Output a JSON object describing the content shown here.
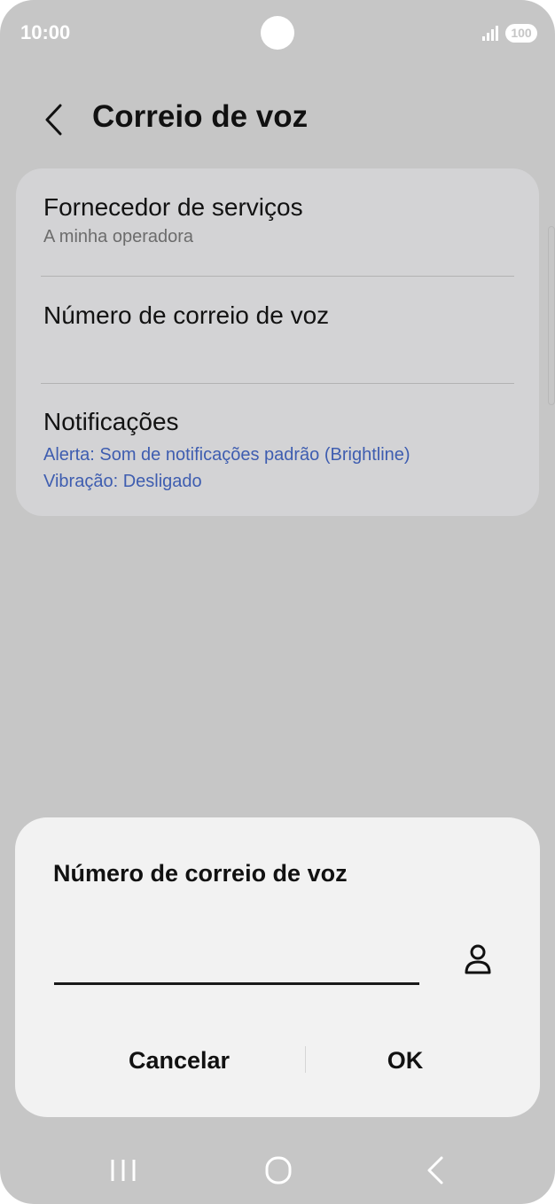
{
  "status_bar": {
    "time": "10:00",
    "battery": "100",
    "colors": {
      "icons": "#ffffff"
    }
  },
  "header": {
    "back_icon": "chevron-left-icon",
    "title": "Correio de voz"
  },
  "settings": {
    "items": [
      {
        "title": "Fornecedor de serviços",
        "subtitle": "A minha operadora"
      },
      {
        "title": "Número de correio de voz"
      },
      {
        "title": "Notificações",
        "lines": [
          "Alerta: Som de notificações padrão (Brightline)",
          "Vibração: Desligado"
        ]
      }
    ]
  },
  "dialog": {
    "title": "Número de correio de voz",
    "input": {
      "value": "",
      "placeholder": ""
    },
    "contact_icon": "person-icon",
    "buttons": {
      "cancel": "Cancelar",
      "ok": "OK"
    }
  },
  "nav_bar": {
    "icons": [
      "recent-apps-icon",
      "home-icon",
      "back-icon"
    ]
  },
  "colors": {
    "background": "#c6c6c6",
    "card": "#d3d3d5",
    "dialog": "#f2f2f2",
    "link_blue": "#3e5db0"
  }
}
